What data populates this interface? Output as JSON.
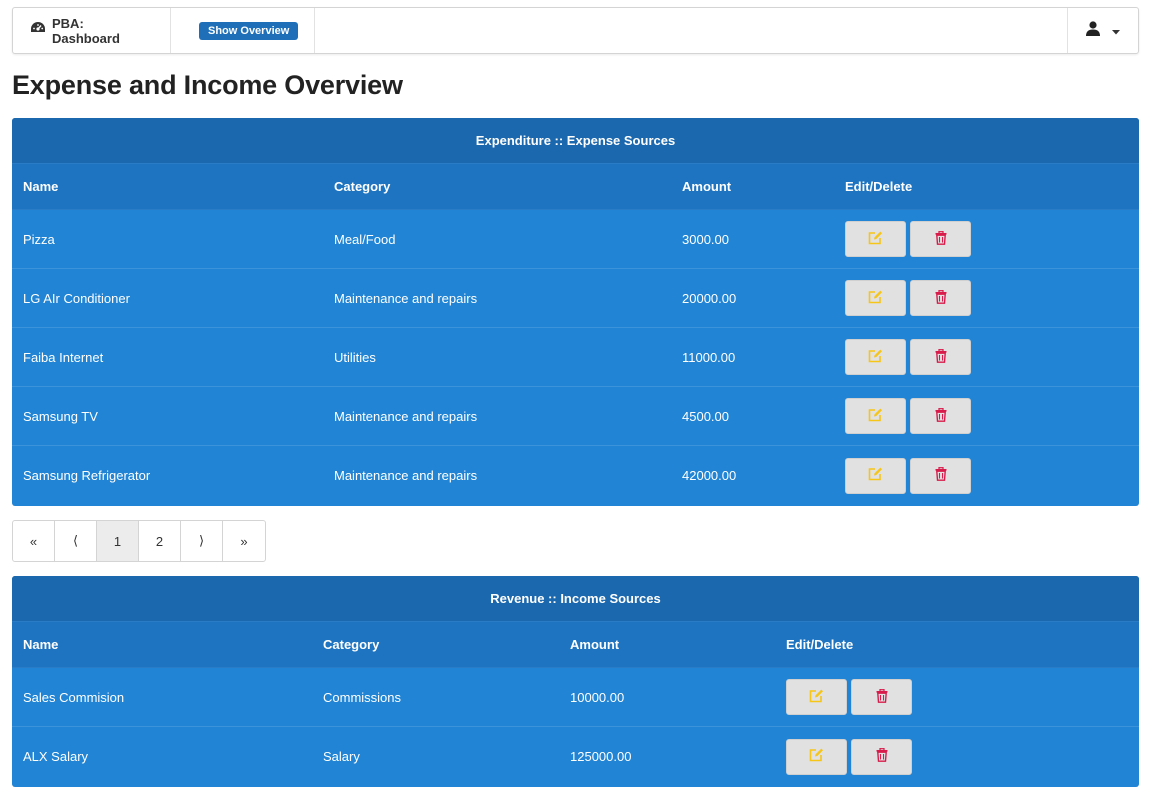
{
  "navbar": {
    "brand": "PBA: Dashboard",
    "brand_icon": "dashboard-icon",
    "overview_button": "Show Overview",
    "user_icon": "user-icon",
    "dropdown_icon": "caret-down-icon"
  },
  "page_title": "Expense and Income Overview",
  "expenses": {
    "title": "Expenditure :: Expense Sources",
    "columns": [
      "Name",
      "Category",
      "Amount",
      "Edit/Delete"
    ],
    "rows": [
      {
        "name": "Pizza",
        "category": "Meal/Food",
        "amount": "3000.00"
      },
      {
        "name": "LG AIr Conditioner",
        "category": "Maintenance and repairs",
        "amount": "20000.00"
      },
      {
        "name": "Faiba Internet",
        "category": "Utilities",
        "amount": "11000.00"
      },
      {
        "name": "Samsung TV",
        "category": "Maintenance and repairs",
        "amount": "4500.00"
      },
      {
        "name": "Samsung Refrigerator",
        "category": "Maintenance and repairs",
        "amount": "42000.00"
      }
    ]
  },
  "pagination": {
    "items": [
      "«",
      "⟨",
      "1",
      "2",
      "⟩",
      "»"
    ],
    "active": "1"
  },
  "income": {
    "title": "Revenue :: Income Sources",
    "columns": [
      "Name",
      "Category",
      "Amount",
      "Edit/Delete"
    ],
    "rows": [
      {
        "name": "Sales Commision",
        "category": "Commissions",
        "amount": "10000.00"
      },
      {
        "name": "ALX Salary",
        "category": "Salary",
        "amount": "125000.00"
      }
    ]
  },
  "colors": {
    "panel_header": "#1c68ae",
    "table_bg": "#2184d4",
    "edit_icon": "#f5c518",
    "delete_icon": "#d81b4a",
    "overview_button": "#1f6fb8"
  }
}
